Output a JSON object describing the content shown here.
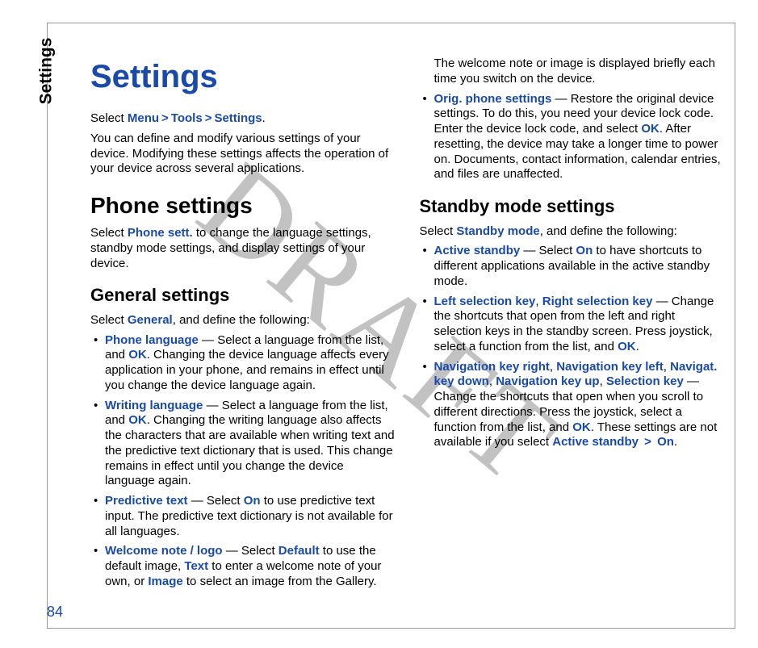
{
  "sideTab": "Settings",
  "pageNumber": "84",
  "watermark": "DRAFT",
  "title": "Settings",
  "intro": {
    "select_prefix": "Select ",
    "menu": "Menu",
    "gt1": ">",
    "tools": "Tools",
    "gt2": ">",
    "settings": "Settings",
    "period": ".",
    "para": "You can define and modify various settings of your device. Modifying these settings affects the operation of your device across several applications."
  },
  "phoneSettings": {
    "heading": "Phone settings",
    "pre": "Select ",
    "kw": "Phone sett.",
    "post": " to change the language settings, standby mode settings, and display settings of your device."
  },
  "general": {
    "heading": "General settings",
    "pre": "Select ",
    "kw": "General",
    "post": ", and define the following:",
    "items": [
      {
        "kw": "Phone language",
        "dash": " — ",
        "t1": "Select a language from the list, and ",
        "kw2": "OK",
        "t2": ". Changing the device language affects every application in your phone, and remains in effect until you change the device language again."
      },
      {
        "kw": "Writing language",
        "dash": " — ",
        "t1": "Select a language from the list, and ",
        "kw2": "OK",
        "t2": ". Changing the writing language also affects the characters that are available when writing text and the predictive text dictionary that is used. This change remains in effect until you change the device language again."
      },
      {
        "kw": "Predictive text",
        "dash": " — ",
        "t1": "Select ",
        "kw2": "On",
        "t2": " to use predictive text input. The predictive text dictionary is not available for all languages."
      },
      {
        "kw": "Welcome note / logo",
        "dash": " — ",
        "t1": "Select ",
        "kw2": "Default",
        "t2": " to use the default image, ",
        "kw3": "Text",
        "t3": " to enter a welcome note of your own, or ",
        "kw4": "Image",
        "t4": " to select an image from the Gallery. The welcome note or image is displayed briefly each time you switch on the device."
      },
      {
        "kw": "Orig. phone settings",
        "dash": " — ",
        "t1": "Restore the original device settings. To do this, you need your device lock code. Enter the device lock code, and select ",
        "kw2": "OK",
        "t2": ". After resetting, the device may take a longer time to power on. Documents, contact information, calendar entries, and files are unaffected."
      }
    ]
  },
  "standby": {
    "heading": "Standby mode settings",
    "pre": "Select ",
    "kw": "Standby mode",
    "post": ", and define the following:",
    "items": [
      {
        "kw": "Active standby",
        "dash": " — ",
        "t1": "Select ",
        "kw2": "On",
        "t2": " to have shortcuts to different applications available in the active standby mode."
      },
      {
        "kw": "Left selection key",
        "comma1": ", ",
        "kw2": "Right selection key",
        "dash": " — ",
        "t1": "Change the shortcuts that open from the left and right selection keys in the standby screen. Press joystick, select a function from the list, and ",
        "kw3": "OK",
        "t2": "."
      },
      {
        "kw": "Navigation key right",
        "c1": ", ",
        "kw2": "Navigation key left",
        "c2": ", ",
        "kw3": "Navigat. key down",
        "c3": ", ",
        "kw4": "Navigation key up",
        "c4": ", ",
        "kw5": "Selection key",
        "dash": " — ",
        "t1": "Change the shortcuts that open when you scroll to different directions. Press the joystick, select a function from the list, and ",
        "kw6": "OK",
        "t2": ". These settings are not available if you select ",
        "kw7": "Active standby",
        "gt": " > ",
        "kw8": "On",
        "t3": "."
      }
    ]
  }
}
